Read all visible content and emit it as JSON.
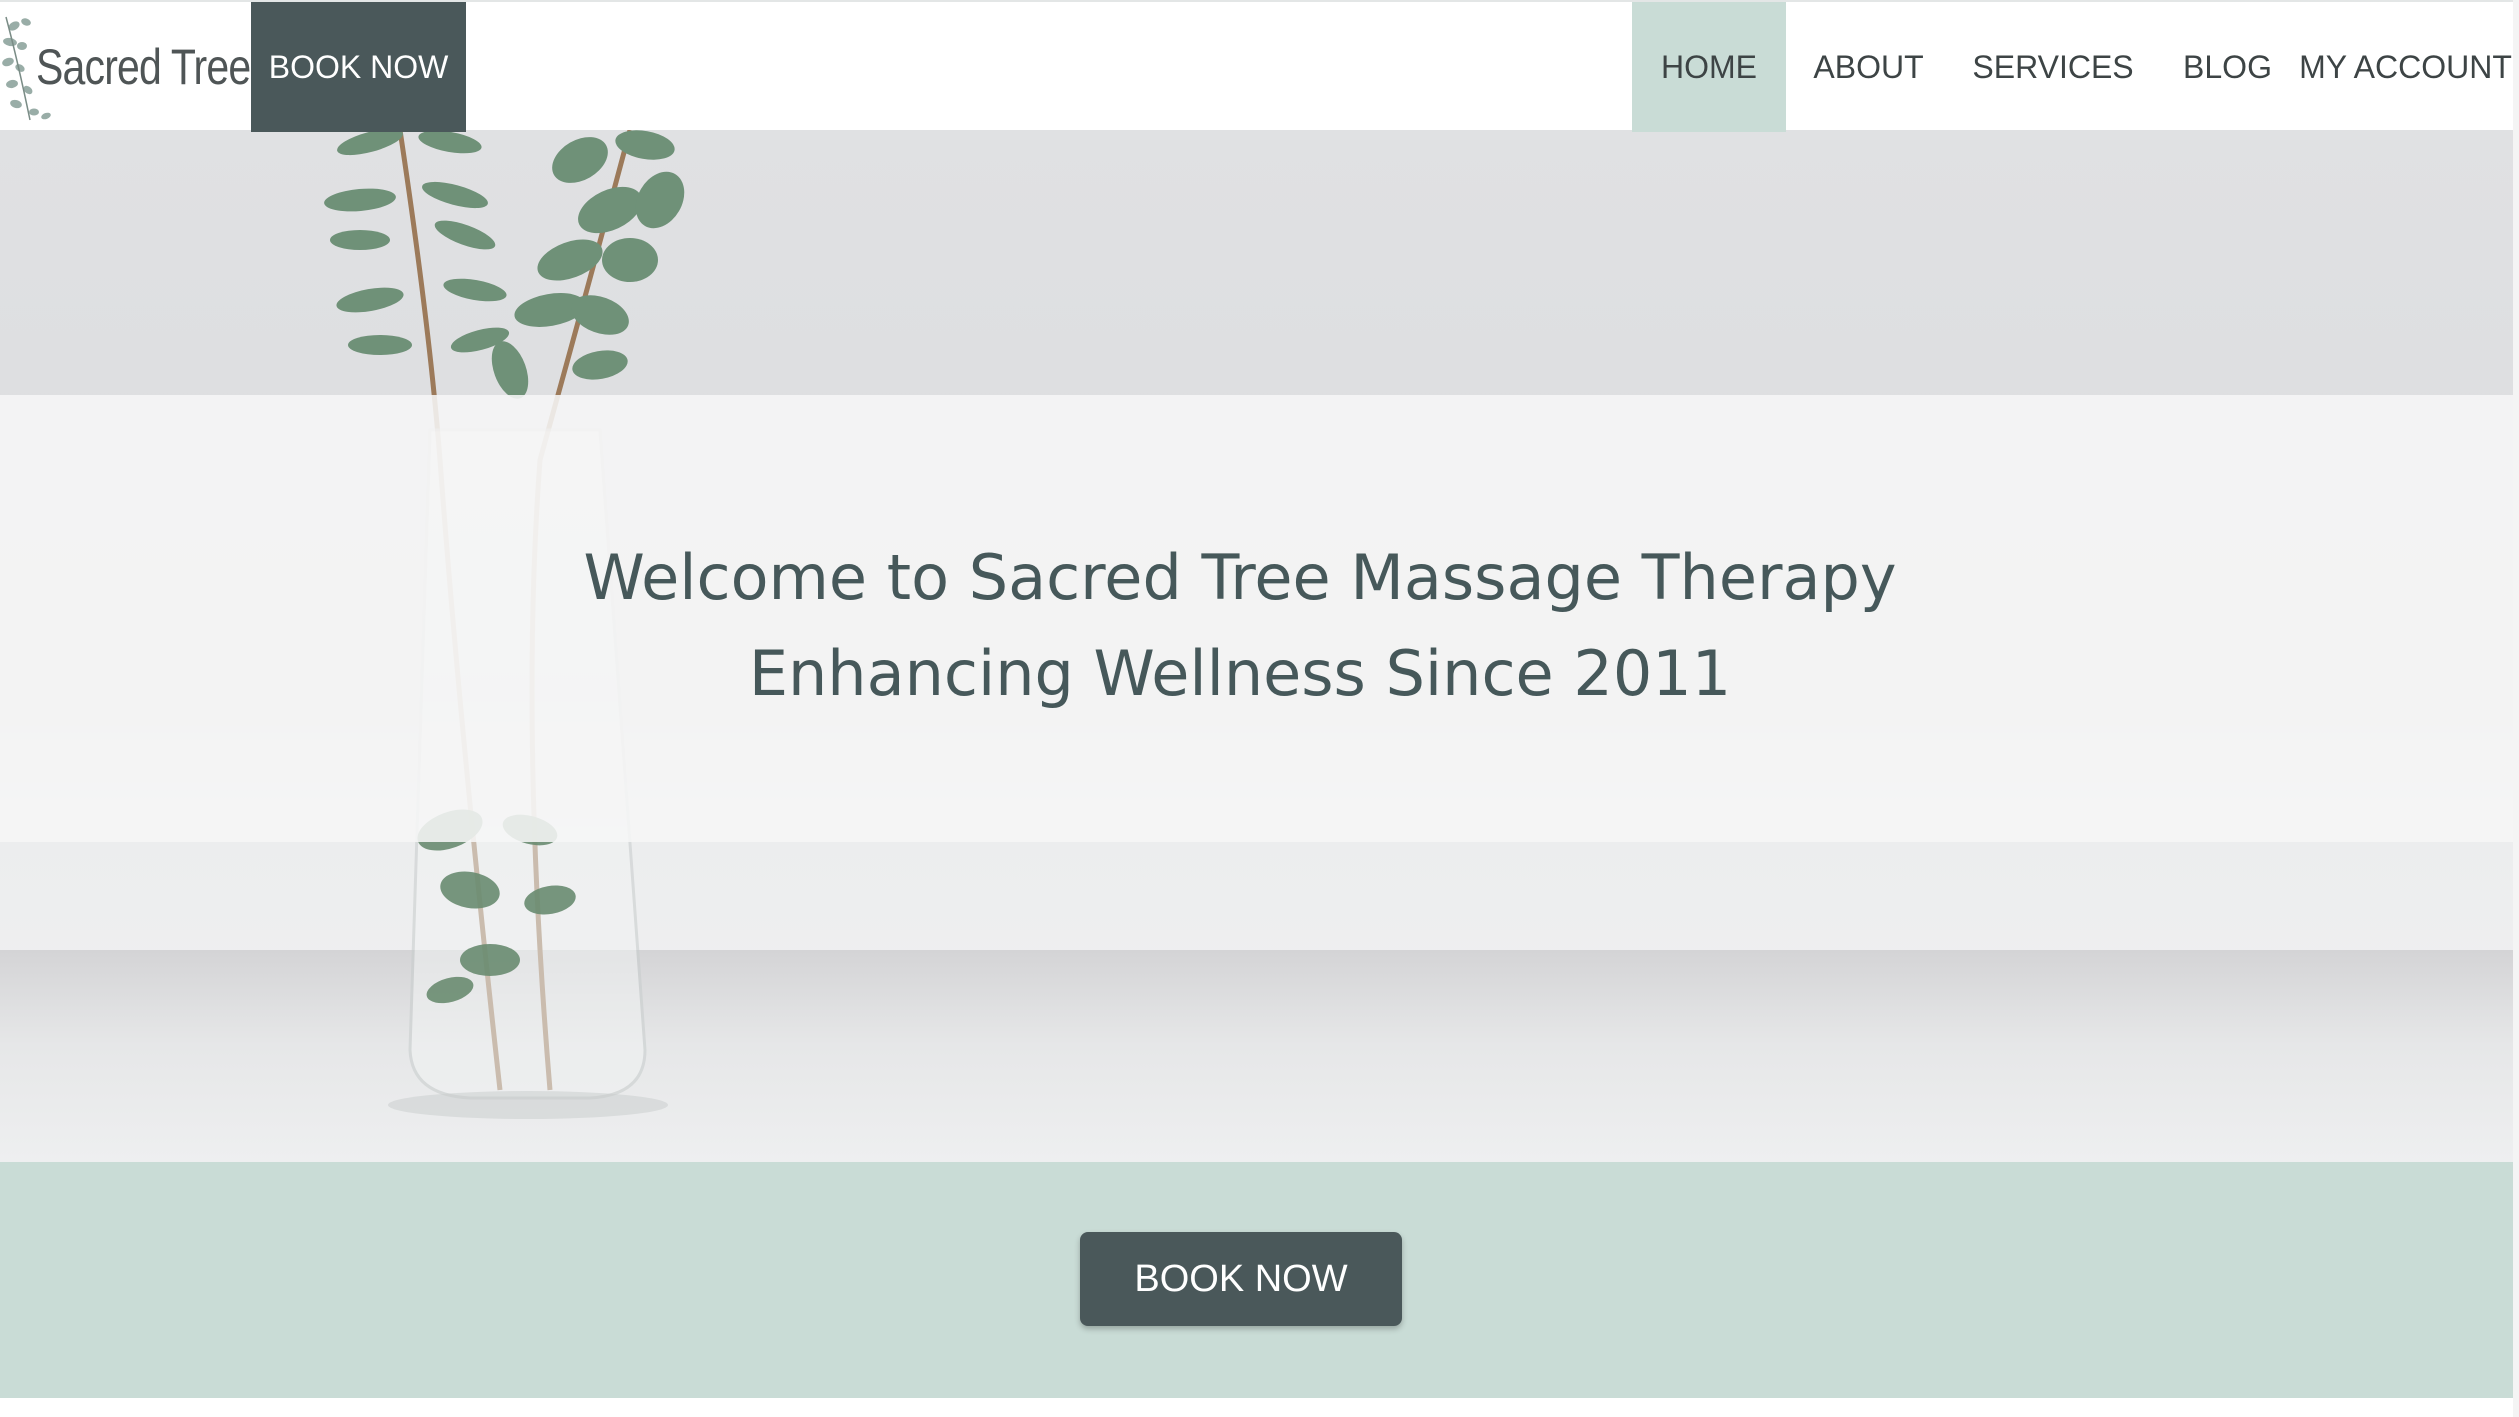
{
  "header": {
    "logo_text": "Sacred Tree",
    "book_now_label": "BOOK NOW",
    "nav": [
      {
        "label": "HOME",
        "active": true
      },
      {
        "label": "ABOUT"
      },
      {
        "label": "SERVICES"
      },
      {
        "label": "BLOG"
      },
      {
        "label": "MY ACCOUNT"
      }
    ]
  },
  "hero": {
    "title_line1": "Welcome to Sacred Tree Massage Therapy",
    "title_line2": "Enhancing Wellness Since 2011"
  },
  "cta": {
    "book_now_label": "BOOK NOW"
  },
  "colors": {
    "accent": "#c9dcd6",
    "button": "#4a585a",
    "text": "#46585a"
  }
}
